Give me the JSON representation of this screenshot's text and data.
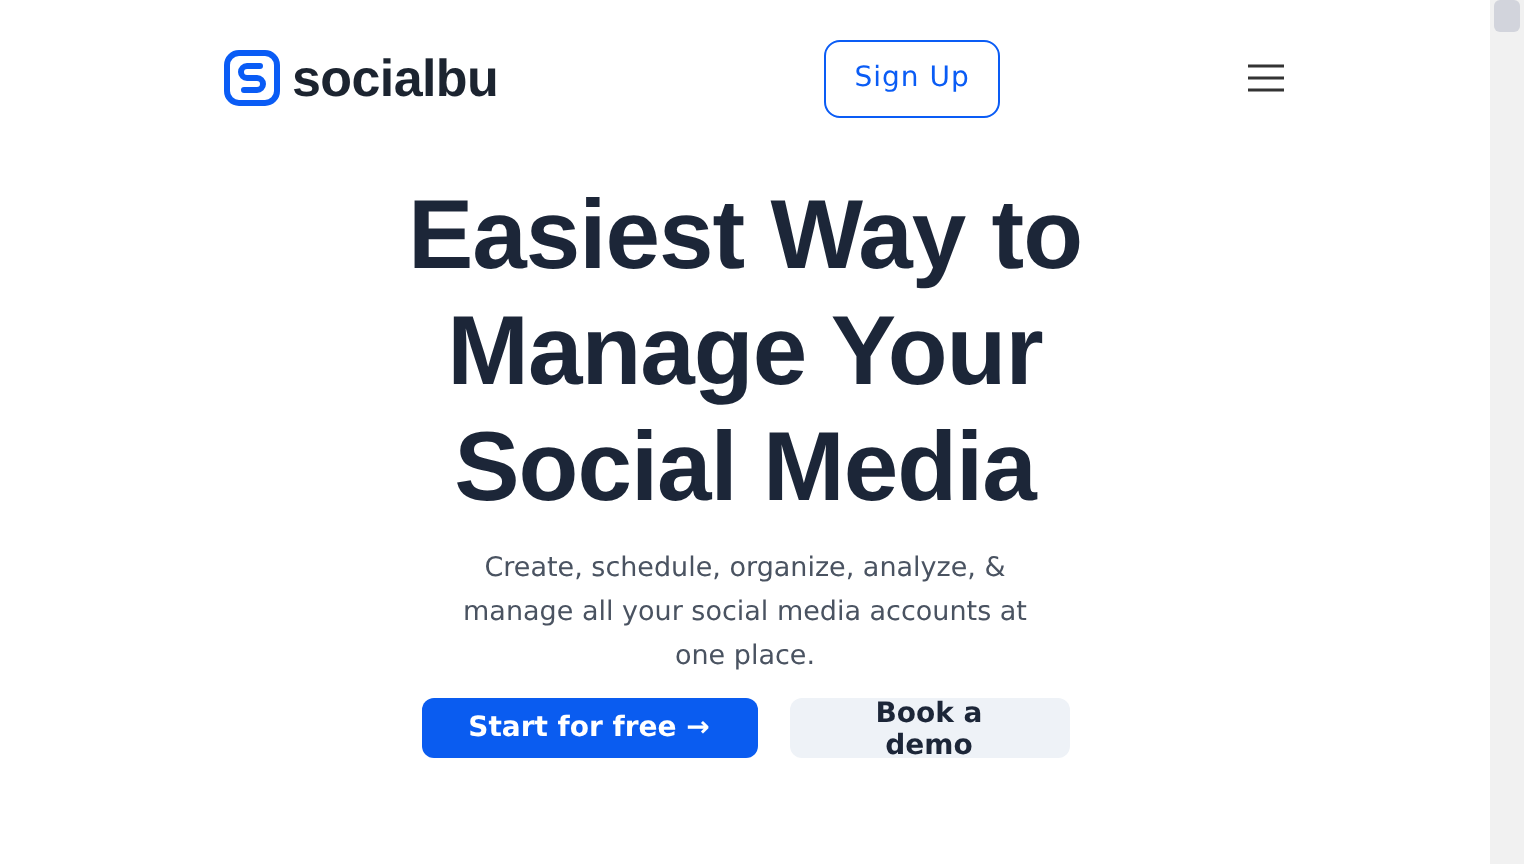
{
  "header": {
    "logo_text": "socialbu",
    "signup_button": "Sign Up"
  },
  "hero": {
    "headline_lines": [
      "Easiest Way to",
      "Manage Your",
      "Social Media"
    ],
    "subtitle": "Create, schedule, organize, analyze, & manage all your social media accounts at one place.",
    "buttons": [
      {
        "label": "Start for free →",
        "kind": "primary"
      },
      {
        "label": "Book a demo",
        "kind": "secondary"
      }
    ]
  }
}
